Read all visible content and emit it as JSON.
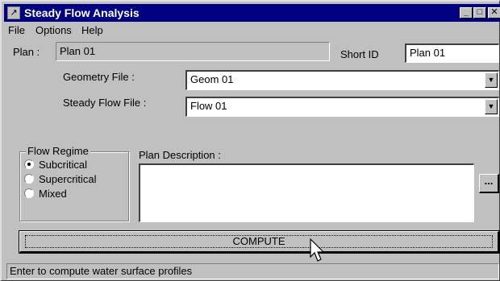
{
  "window": {
    "title": "Steady Flow Analysis",
    "app_icon": "cursor-arrow-icon"
  },
  "menu": [
    "File",
    "Options",
    "Help"
  ],
  "plan": {
    "label": "Plan :",
    "value": "Plan 01",
    "short_id_label": "Short ID",
    "short_id_value": "Plan 01"
  },
  "geometry": {
    "label": "Geometry File :",
    "value": "Geom 01"
  },
  "flow": {
    "label": "Steady Flow File :",
    "value": "Flow 01"
  },
  "flow_regime": {
    "legend": "Flow Regime",
    "options": [
      {
        "label": "Subcritical",
        "selected": true
      },
      {
        "label": "Supercritical",
        "selected": false
      },
      {
        "label": "Mixed",
        "selected": false
      }
    ]
  },
  "description": {
    "label": "Plan Description :",
    "value": "",
    "ellipsis_label": "..."
  },
  "compute": {
    "label": "COMPUTE"
  },
  "status": {
    "text": "Enter to compute water surface profiles"
  }
}
